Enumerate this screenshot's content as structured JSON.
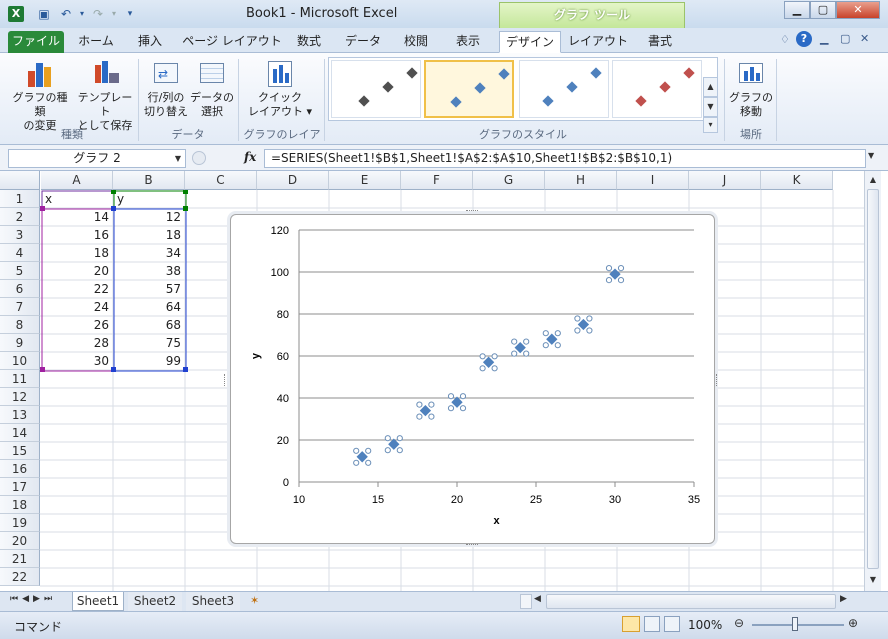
{
  "app": {
    "window_title": "Book1 - Microsoft Excel",
    "context_group": "グラフ ツール",
    "xl_icon": "X"
  },
  "tabs": [
    "ファイル",
    "ホーム",
    "挿入",
    "ページ レイアウト",
    "数式",
    "データ",
    "校閲",
    "表示",
    "デザイン",
    "レイアウト",
    "書式"
  ],
  "ribbon": {
    "change_type_label": "グラフの種類\nの変更",
    "save_template_label": "テンプレート\nとして保存",
    "group_type": "種類",
    "switch_rowcol_label": "行/列の\n切り替え",
    "select_data_label": "データの\n選択",
    "group_data": "データ",
    "quick_layout_label": "クイック\nレイアウト ▾",
    "group_layout": "グラフのレイアウト",
    "group_style": "グラフのスタイル",
    "move_chart_label": "グラフの\n移動",
    "group_location": "場所"
  },
  "formula_bar": {
    "name_box": "グラフ 2",
    "fx": "fx",
    "formula": "=SERIES(Sheet1!$B$1,Sheet1!$A$2:$A$10,Sheet1!$B$2:$B$10,1)"
  },
  "columns": [
    "A",
    "B",
    "C",
    "D",
    "E",
    "F",
    "G",
    "H",
    "I",
    "J",
    "K"
  ],
  "rows": [
    "1",
    "2",
    "3",
    "4",
    "5",
    "6",
    "7",
    "8",
    "9",
    "10",
    "11",
    "12",
    "13",
    "14",
    "15",
    "16",
    "17",
    "18",
    "19",
    "20",
    "21",
    "22"
  ],
  "cells": {
    "header_a": "x",
    "header_b": "y",
    "col_a": [
      "14",
      "16",
      "18",
      "20",
      "22",
      "24",
      "26",
      "28",
      "30"
    ],
    "col_b": [
      "12",
      "18",
      "34",
      "38",
      "57",
      "64",
      "68",
      "75",
      "99"
    ]
  },
  "chart_data": {
    "type": "scatter",
    "x": [
      14,
      16,
      18,
      20,
      22,
      24,
      26,
      28,
      30
    ],
    "series": [
      {
        "values": [
          12,
          18,
          34,
          38,
          57,
          64,
          68,
          75,
          99
        ]
      }
    ],
    "xlabel": "x",
    "ylabel": "y",
    "xlim": [
      10,
      35
    ],
    "ylim": [
      0,
      120
    ],
    "xticks": [
      "10",
      "15",
      "20",
      "25",
      "30",
      "35"
    ],
    "yticks": [
      "0",
      "20",
      "40",
      "60",
      "80",
      "100",
      "120"
    ],
    "grid": "horizontal",
    "marker_color": "#4f81bd"
  },
  "sheets": [
    "Sheet1",
    "Sheet2",
    "Sheet3"
  ],
  "status": {
    "mode": "コマンド",
    "zoom": "100%"
  }
}
